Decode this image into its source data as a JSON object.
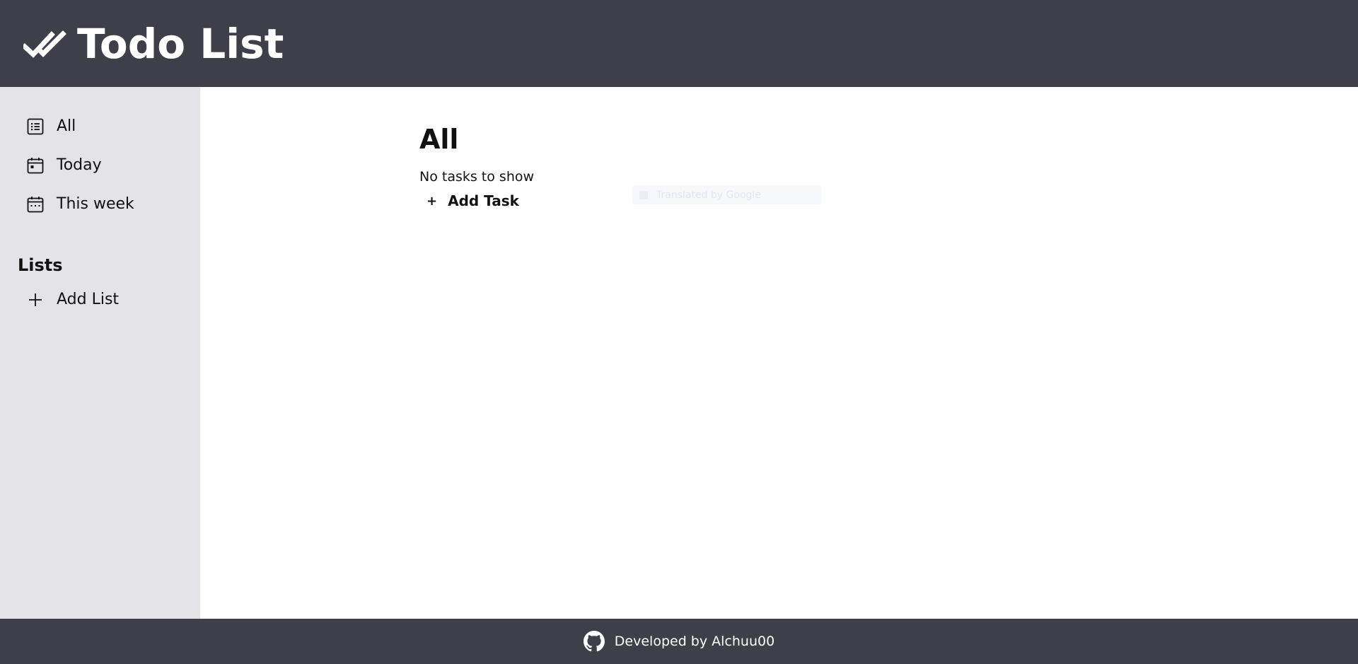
{
  "header": {
    "icon": "double-check-icon",
    "title": "Todo List"
  },
  "sidebar": {
    "items": [
      {
        "label": "All",
        "icon": "list-icon"
      },
      {
        "label": "Today",
        "icon": "calendar-today-icon"
      },
      {
        "label": "This week",
        "icon": "calendar-week-icon"
      }
    ],
    "lists_heading": "Lists",
    "add_list": {
      "label": "Add List",
      "icon": "plus-icon"
    }
  },
  "main": {
    "title": "All",
    "empty_message": "No tasks to show",
    "add_task": {
      "plus": "+",
      "label": "Add Task"
    },
    "ghost_field": {
      "text": "Translated by Google"
    }
  },
  "footer": {
    "icon": "github-icon",
    "text": "Developed by Alchuu00"
  },
  "colors": {
    "header_bg": "#3f3f49",
    "sidebar_bg": "#e4e3e8",
    "main_bg": "#ffffff",
    "footer_bg": "#3f3f49"
  }
}
